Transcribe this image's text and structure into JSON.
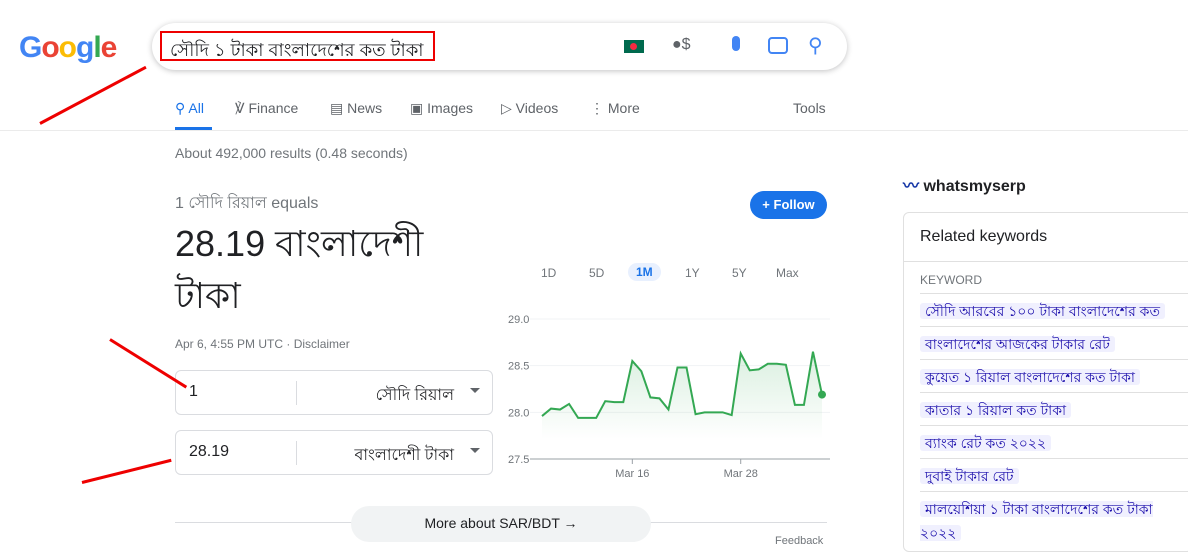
{
  "search": {
    "query": "সৌদি ১ টাকা বাংলাদেশের কত টাকা"
  },
  "tabs": [
    {
      "label": "All",
      "icon": "search-icon"
    },
    {
      "label": "Finance",
      "icon": "finance-icon"
    },
    {
      "label": "News",
      "icon": "news-icon"
    },
    {
      "label": "Images",
      "icon": "image-icon"
    },
    {
      "label": "Videos",
      "icon": "video-icon"
    },
    {
      "label": "More",
      "icon": "more-vert-icon"
    }
  ],
  "tools": "Tools",
  "stats": "About 492,000 results (0.48 seconds)",
  "converter": {
    "equals": "1 সৌদি রিয়াল equals",
    "result": "28.19 বাংলাদেশী টাকা",
    "date": "Apr 6, 4:55 PM UTC · Disclaimer",
    "from_value": "1",
    "from_unit": "সৌদি রিয়াল",
    "to_value": "28.19",
    "to_unit": "বাংলাদেশী টাকা",
    "follow": "Follow",
    "ranges": [
      "1D",
      "5D",
      "1M",
      "1Y",
      "5Y",
      "Max"
    ],
    "selected_range": "1M",
    "more": "More about SAR/BDT",
    "feedback": "Feedback"
  },
  "chart_data": {
    "type": "line",
    "color": "#34a853",
    "ylim": [
      27.5,
      29.0
    ],
    "yticks": [
      "29.0",
      "28.5",
      "28.0",
      "27.5"
    ],
    "xticks": [
      "Mar 16",
      "Mar 28"
    ],
    "x": [
      "Mar 6",
      "Mar 7",
      "Mar 8",
      "Mar 9",
      "Mar 10",
      "Mar 11",
      "Mar 12",
      "Mar 13",
      "Mar 14",
      "Mar 15",
      "Mar 16",
      "Mar 17",
      "Mar 18",
      "Mar 19",
      "Mar 20",
      "Mar 21",
      "Mar 22",
      "Mar 23",
      "Mar 24",
      "Mar 25",
      "Mar 26",
      "Mar 27",
      "Mar 28",
      "Mar 29",
      "Mar 30",
      "Mar 31",
      "Apr 1",
      "Apr 2",
      "Apr 3",
      "Apr 4",
      "Apr 5",
      "Apr 6"
    ],
    "values": [
      27.96,
      28.04,
      28.03,
      28.09,
      27.94,
      27.94,
      27.94,
      28.12,
      28.11,
      28.11,
      28.55,
      28.44,
      28.16,
      28.15,
      28.03,
      28.48,
      28.48,
      27.98,
      28.0,
      28.0,
      28.0,
      27.97,
      28.63,
      28.45,
      28.46,
      28.52,
      28.52,
      28.51,
      28.08,
      28.08,
      28.65,
      28.19
    ]
  },
  "sidebar": {
    "brand": "whatsmyserp",
    "title": "Related keywords",
    "header": "KEYWORD",
    "keywords": [
      "সৌদি আরবের ১০০ টাকা বাংলাদেশের কত",
      "বাংলাদেশের আজকের টাকার রেট",
      "কুয়েত ১ রিয়াল বাংলাদেশের কত টাকা",
      "কাতার ১ রিয়াল কত টাকা",
      "ব্যাংক রেট কত ২০২২",
      "দুবাই টাকার রেট",
      "মালয়েশিয়া ১ টাকা বাংলাদেশের কত টাকা ২০২২"
    ]
  }
}
